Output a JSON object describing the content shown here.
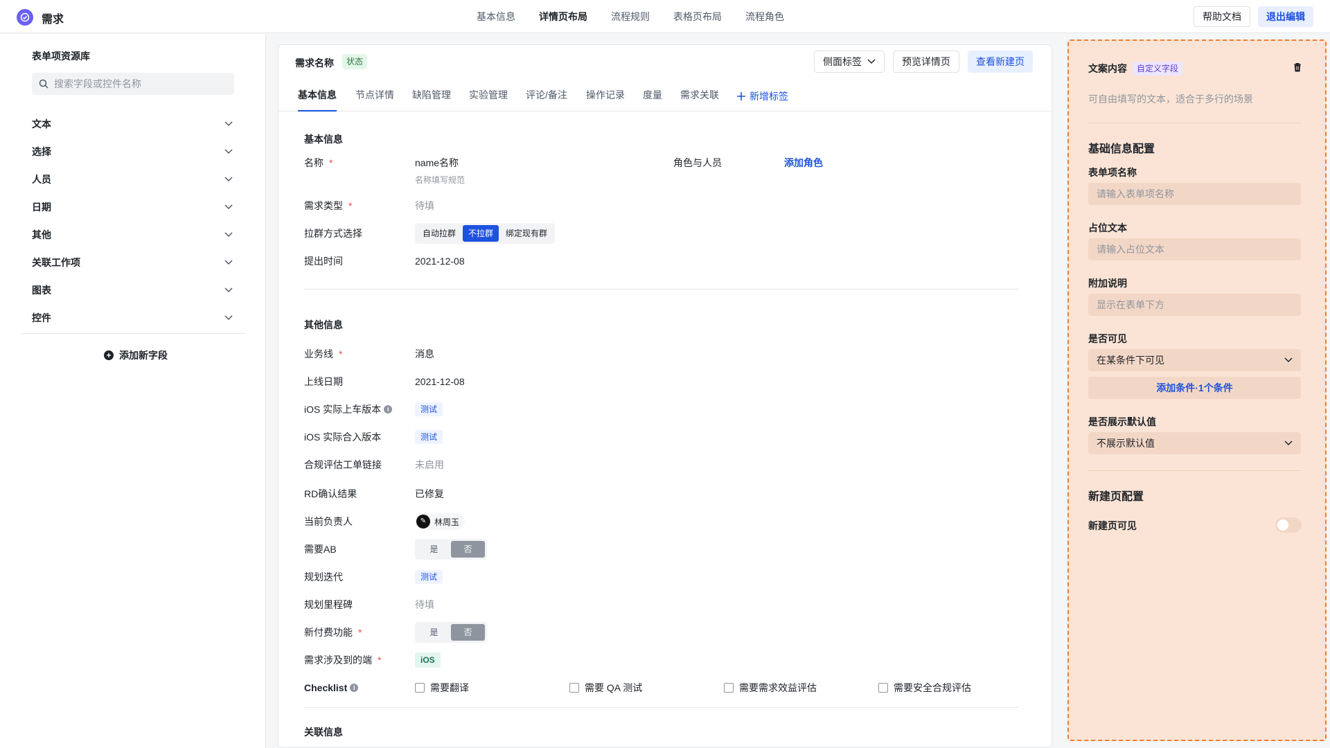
{
  "app": {
    "title": "需求"
  },
  "nav": {
    "items": [
      "基本信息",
      "详情页布局",
      "流程规则",
      "表格页布局",
      "流程角色"
    ],
    "active_index": 1
  },
  "top_actions": {
    "help": "帮助文档",
    "exit": "退出编辑"
  },
  "sidebar": {
    "title": "表单项资源库",
    "search_placeholder": "搜索字段或控件名称",
    "items": [
      "文本",
      "选择",
      "人员",
      "日期",
      "其他",
      "关联工作项",
      "图表",
      "控件"
    ],
    "add_field": "添加新字段"
  },
  "card": {
    "title": "需求名称",
    "status_tag": "状态",
    "side_tab_button": "侧面标签",
    "preview_button": "预览详情页",
    "new_page_button": "查看新建页",
    "tabs": [
      "基本信息",
      "节点详情",
      "缺陷管理",
      "实验管理",
      "评论/备注",
      "操作记录",
      "度量",
      "需求关联"
    ],
    "add_tab": "新增标签",
    "sections": {
      "basic": "基本信息",
      "other": "其他信息",
      "related": "关联信息"
    },
    "basic": {
      "name_label": "名称",
      "name_value": "name名称",
      "name_hint": "名称填写规范",
      "role_label": "角色与人员",
      "role_link": "添加角色",
      "type_label": "需求类型",
      "type_value": "待填",
      "group_label": "拉群方式选择",
      "group_options": [
        "自动拉群",
        "不拉群",
        "绑定现有群"
      ],
      "group_selected": 1,
      "time_label": "提出时间",
      "time_value": "2021-12-08"
    },
    "other": {
      "business_label": "业务线",
      "business_value": "消息",
      "online_label": "上线日期",
      "online_value": "2021-12-08",
      "ios_car_label": "iOS 实际上车版本",
      "ios_car_value": "测试",
      "ios_merge_label": "iOS 实际合入版本",
      "ios_merge_value": "测试",
      "compliance_label": "合规评估工单链接",
      "compliance_value": "未启用",
      "rd_label": "RD确认结果",
      "rd_value": "已修复",
      "owner_label": "当前负责人",
      "owner_value": "林周玉",
      "ab_label": "需要AB",
      "ab_yes": "是",
      "ab_no": "否",
      "iteration_label": "规划迭代",
      "iteration_value": "测试",
      "milestone_label": "规划里程碑",
      "milestone_value": "待填",
      "paid_label": "新付费功能",
      "paid_yes": "是",
      "paid_no": "否",
      "platform_label": "需求涉及到的端",
      "platform_value": "iOS",
      "checklist_label": "Checklist",
      "checklist_items": [
        "需要翻译",
        "需要 QA 测试",
        "需要需求效益评估",
        "需要安全合规评估"
      ]
    }
  },
  "panel": {
    "title": "文案内容",
    "tag": "自定义字段",
    "description": "可自由填写的文本，适合于多行的场景",
    "basic_section": "基础信息配置",
    "name_label": "表单项名称",
    "name_placeholder": "请输入表单项名称",
    "placeholder_label": "占位文本",
    "placeholder_placeholder": "请输入占位文本",
    "extra_label": "附加说明",
    "extra_placeholder": "显示在表单下方",
    "visible_label": "是否可见",
    "visible_value": "在某条件下可见",
    "add_condition": "添加条件·1个条件",
    "default_label": "是否展示默认值",
    "default_value": "不展示默认值",
    "new_section": "新建页配置",
    "new_visible_label": "新建页可见",
    "new_visible_on": false
  },
  "colors": {
    "accent": "#1e52e0",
    "panel_bg": "#fbe4d5",
    "panel_border": "#f07c2e",
    "required": "#f54a45"
  }
}
